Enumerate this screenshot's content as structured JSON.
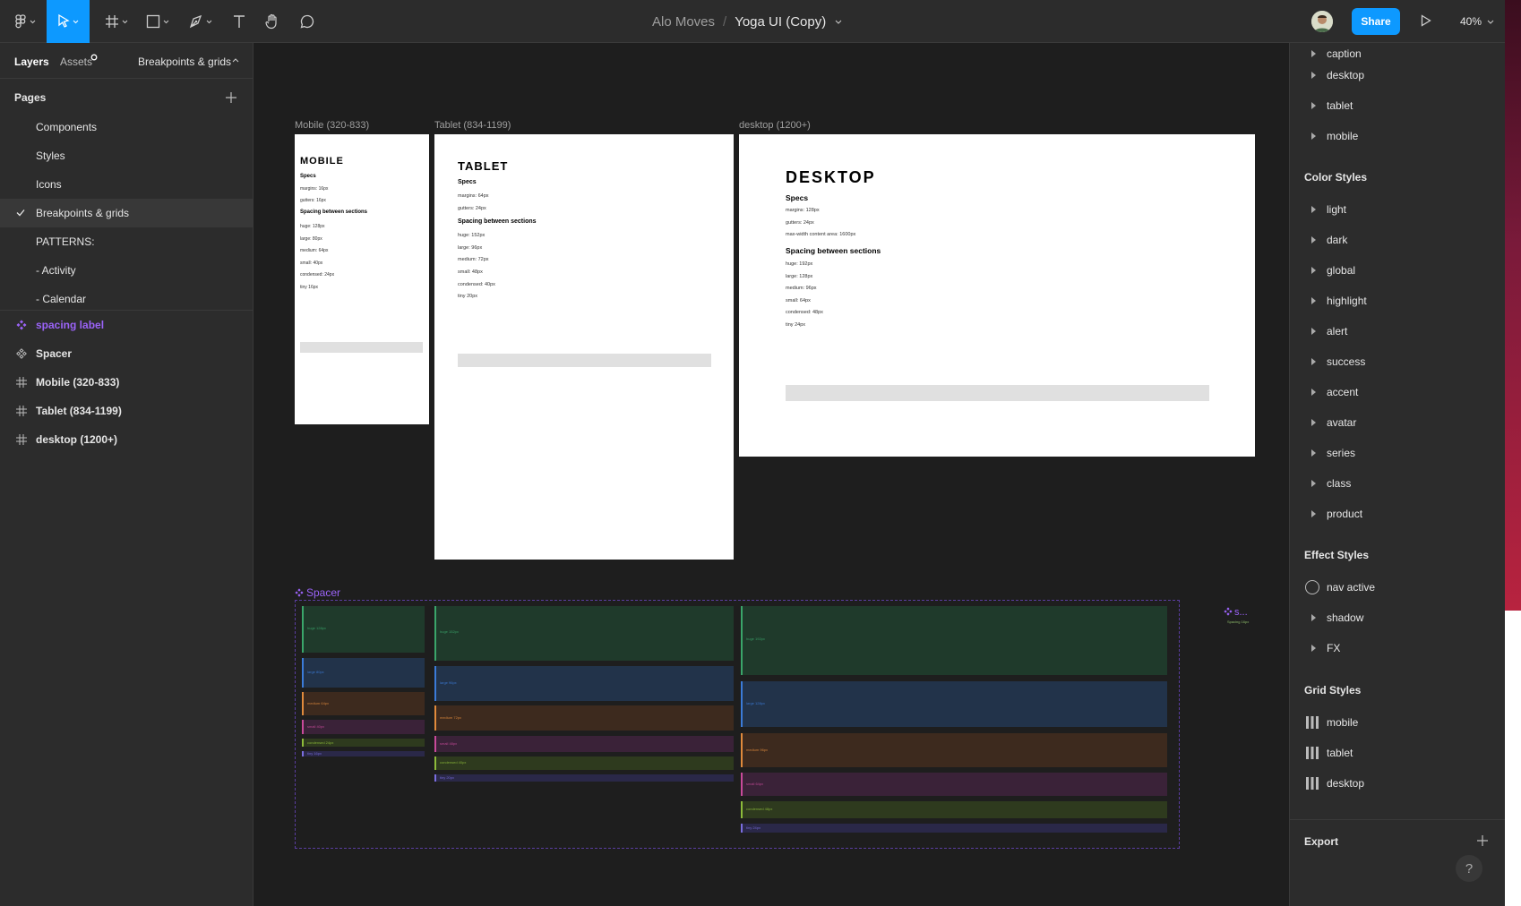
{
  "toolbar": {
    "project": "Alo Moves",
    "separator": "/",
    "file": "Yoga UI (Copy)",
    "share_label": "Share",
    "zoom": "40%"
  },
  "left_panel": {
    "tabs": [
      "Layers",
      "Assets",
      "Breakpoints & grids"
    ],
    "pages_heading": "Pages",
    "pages": [
      "Components",
      "Styles",
      "Icons",
      "Breakpoints & grids",
      "PATTERNS:",
      "- Activity",
      "- Calendar"
    ],
    "selected_page": "Breakpoints & grids",
    "layers": [
      {
        "label": "spacing label",
        "icon": "component-icon"
      },
      {
        "label": "Spacer",
        "icon": "component-icon"
      },
      {
        "label": "Mobile (320-833)",
        "icon": "frame-icon"
      },
      {
        "label": "Tablet (834-1199)",
        "icon": "frame-icon"
      },
      {
        "label": "desktop (1200+)",
        "icon": "frame-icon"
      }
    ]
  },
  "canvas": {
    "frames": {
      "mobile": {
        "label": "Mobile (320-833)",
        "title": "MOBILE",
        "specs": "Specs",
        "lines": [
          [
            "margins:",
            "16px"
          ],
          [
            "gutters:",
            "16px"
          ]
        ],
        "section": "Spacing between sections",
        "sizes": [
          [
            "huge:",
            "128px"
          ],
          [
            "large:",
            "80px"
          ],
          [
            "medium:",
            "64px"
          ],
          [
            "small:",
            "40px"
          ],
          [
            "condensed:",
            "24px"
          ],
          [
            "tiny",
            "16px"
          ]
        ]
      },
      "tablet": {
        "label": "Tablet (834-1199)",
        "title": "TABLET",
        "specs": "Specs",
        "lines": [
          [
            "margins:",
            "64px"
          ],
          [
            "gutters:",
            "24px"
          ]
        ],
        "section": "Spacing between sections",
        "sizes": [
          [
            "huge:",
            "152px"
          ],
          [
            "large:",
            "96px"
          ],
          [
            "medium:",
            "72px"
          ],
          [
            "small:",
            "48px"
          ],
          [
            "condensed:",
            "40px"
          ],
          [
            "tiny",
            "20px"
          ]
        ]
      },
      "desktop": {
        "label": "desktop (1200+)",
        "title": "DESKTOP",
        "specs": "Specs",
        "lines": [
          [
            "margins:",
            "128px"
          ],
          [
            "gutters:",
            "24px"
          ],
          [
            "max-width content area:",
            "1600px"
          ]
        ],
        "section": "Spacing between sections",
        "sizes": [
          [
            "huge:",
            "192px"
          ],
          [
            "large:",
            "128px"
          ],
          [
            "medium:",
            "96px"
          ],
          [
            "small:",
            "64px"
          ],
          [
            "condensed:",
            "48px"
          ],
          [
            "tiny",
            "24px"
          ]
        ]
      }
    },
    "spacer_label": "Spacer",
    "spacer_columns": {
      "mobile": [
        "huge 128px",
        "large 80px",
        "medium 64px",
        "small 40px",
        "condensed 24px",
        "tiny 16px"
      ],
      "tablet": [
        "huge 152px",
        "large 96px",
        "medium 72px",
        "small 48px",
        "condensed 40px",
        "tiny 20px"
      ],
      "desktop": [
        "huge 192px",
        "large 128px",
        "medium 96px",
        "small 64px",
        "condensed 48px",
        "tiny 24px"
      ]
    },
    "spacer_colors": [
      "#1f3a2b",
      "#22334a",
      "#3d2a1e",
      "#3a2238",
      "#2e3a1e",
      "#2a2848"
    ],
    "spacer_border_colors": [
      "#3aa56a",
      "#3b7bd8",
      "#e08a3c",
      "#c84a9a",
      "#8dbb3a",
      "#7a6ee0"
    ],
    "mini_label": "s...",
    "mini_sub": "Spacing 16px"
  },
  "right_panel": {
    "text_styles_tail": [
      "caption",
      "desktop",
      "tablet",
      "mobile"
    ],
    "color_styles_heading": "Color Styles",
    "color_styles": [
      "light",
      "dark",
      "global",
      "highlight",
      "alert",
      "success",
      "accent",
      "avatar",
      "series",
      "class",
      "product"
    ],
    "effect_styles_heading": "Effect Styles",
    "effect_styles": [
      "nav active",
      "shadow",
      "FX"
    ],
    "grid_styles_heading": "Grid Styles",
    "grid_styles": [
      "mobile",
      "tablet",
      "desktop"
    ],
    "export_heading": "Export",
    "help": "?"
  }
}
